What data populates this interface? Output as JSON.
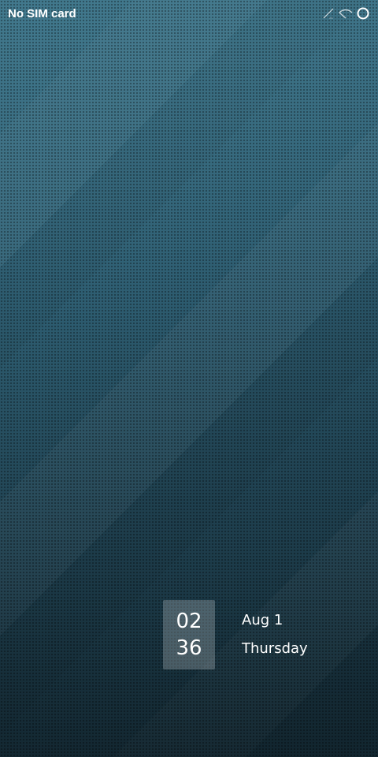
{
  "status_bar": {
    "carrier": "No SIM card",
    "icons": [
      "signal-off-icon",
      "wifi-off-icon",
      "battery-ring-icon"
    ]
  },
  "lock_clock": {
    "hour": "02",
    "minute": "36"
  },
  "date": {
    "month_day": "Aug 1",
    "weekday": "Thursday"
  },
  "colors": {
    "wallpaper_top": "#3d7489",
    "wallpaper_bottom": "#1a3845",
    "text": "#ffffff"
  }
}
